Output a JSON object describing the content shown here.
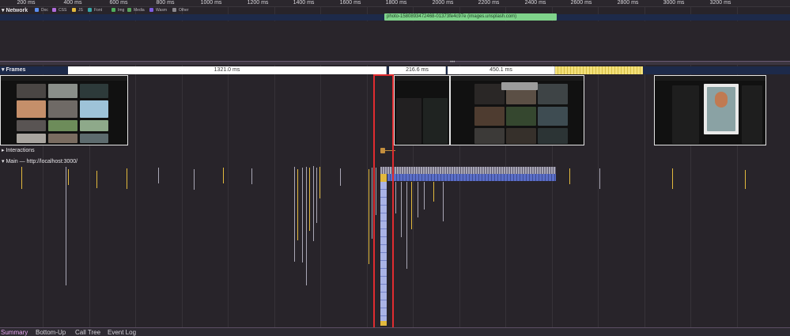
{
  "ruler": {
    "ticks": [
      "200 ms",
      "400 ms",
      "600 ms",
      "800 ms",
      "1000 ms",
      "1200 ms",
      "1400 ms",
      "1600 ms",
      "1800 ms",
      "2000 ms",
      "2200 ms",
      "2400 ms",
      "2600 ms",
      "2800 ms",
      "3000 ms",
      "3200 ms"
    ]
  },
  "network": {
    "title": "Network",
    "legend": [
      {
        "label": "Doc",
        "color": "#5b8ef0"
      },
      {
        "label": "CSS",
        "color": "#b06bdc"
      },
      {
        "label": "JS",
        "color": "#e2b93d"
      },
      {
        "label": "Font",
        "color": "#3aa7a8"
      },
      {
        "label": "Img",
        "color": "#4fae5c"
      },
      {
        "label": "Media",
        "color": "#59a35c"
      },
      {
        "label": "Wasm",
        "color": "#7d5ce0"
      },
      {
        "label": "Other",
        "color": "#8a878d"
      }
    ],
    "request_label": "photo-1580893472468-01373fe4c97e (images.unsplash.com)"
  },
  "frames": {
    "title": "Frames",
    "durations": [
      "1321.0 ms",
      "216.6 ms",
      "450.1 ms"
    ]
  },
  "tracks": {
    "interactions": "Interactions",
    "main": "Main — http://localhost:3000/"
  },
  "tabs": [
    "Summary",
    "Bottom-Up",
    "Call Tree",
    "Event Log"
  ],
  "colors": {
    "highlight": "#e02c30",
    "scripting": "#e2b93d",
    "rendering": "#7784c8",
    "network_image": "#7fd38b",
    "active_tab": "#e9a7f3"
  }
}
